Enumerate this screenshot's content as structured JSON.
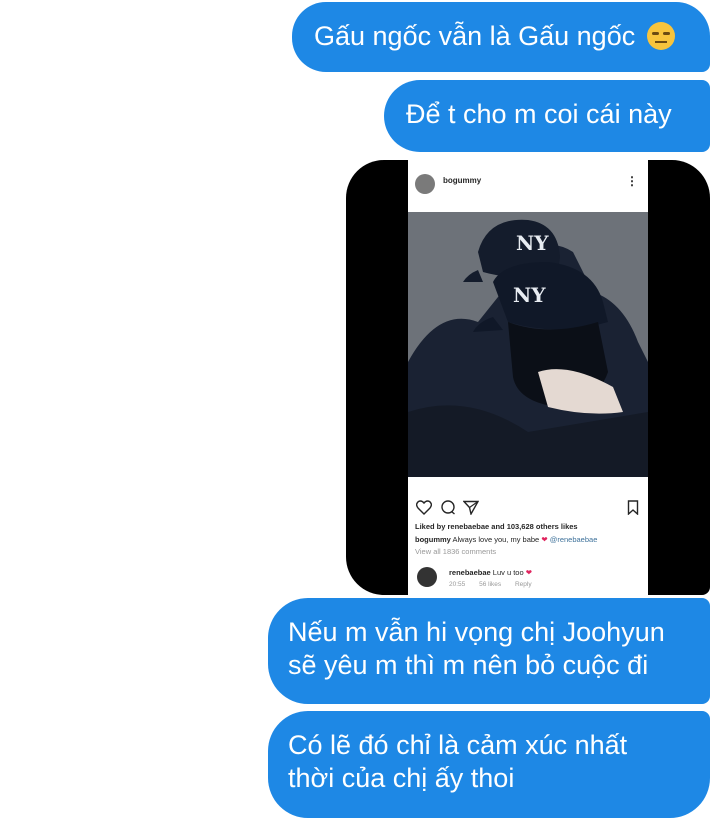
{
  "messages": [
    {
      "text": "Gấu ngốc vẫn là Gấu ngốc",
      "emoji": "expressionless-face-icon"
    },
    {
      "text": "Để t cho m coi cái này"
    },
    {
      "text_line1": "Nếu m vẫn hi vọng chị Joohyun",
      "text_line2": "sẽ yêu m thì m nên bỏ cuộc đi"
    },
    {
      "text_line1": "Có lẽ đó chỉ là cảm xúc nhất",
      "text_line2": "thời của chị ấy thoi"
    }
  ],
  "shared_post": {
    "username": "bogummy",
    "liked_by": "Liked by renebaebae and 103,628 others likes",
    "caption_user": "bogummy",
    "caption_text": "Always love you, my babe",
    "caption_heart": "❤",
    "caption_mention": "@renebaebae",
    "view_all": "View all 1836 comments",
    "comment": {
      "user": "renebaebae",
      "text": "Luv u too",
      "heart": "❤",
      "time": "20:55",
      "likes": "56 likes",
      "reply": "Reply"
    }
  },
  "colors": {
    "bubble": "#1e88e5",
    "bubble_text": "#ffffff",
    "frame": "#000000",
    "mention": "#3f729b",
    "heart": "#e0245e"
  }
}
